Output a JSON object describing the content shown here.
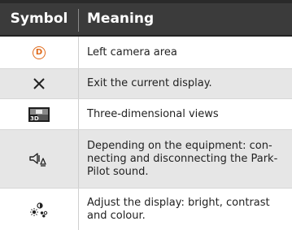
{
  "table": {
    "header": {
      "symbol": "Symbol",
      "meaning": "Meaning"
    },
    "rows": [
      {
        "icon": "d-circle-icon",
        "icon_text": "D",
        "icon_color": "#e06a1a",
        "meaning_lines": [
          "Left camera area"
        ]
      },
      {
        "icon": "close-x-icon",
        "meaning_lines": [
          "Exit the current display."
        ]
      },
      {
        "icon": "three-dimensional-view-icon",
        "icon_text": "3D",
        "meaning_lines": [
          "Three-dimensional views"
        ]
      },
      {
        "icon": "speaker-mute-icon",
        "meaning_lines": [
          "Depending on the equipment: con-",
          "necting and disconnecting the Park-",
          "Pilot sound."
        ]
      },
      {
        "icon": "display-settings-icon",
        "meaning_lines": [
          "Adjust the display: bright, contrast",
          "and colour."
        ]
      }
    ]
  }
}
